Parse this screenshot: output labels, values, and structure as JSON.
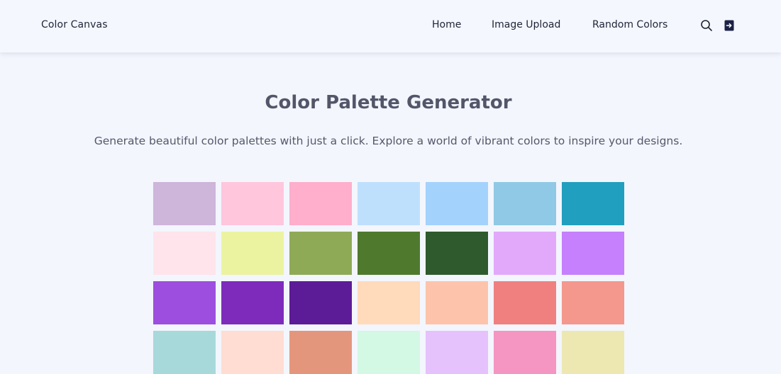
{
  "navbar": {
    "brand": "Color Canvas",
    "links": [
      "Home",
      "Image Upload",
      "Random Colors"
    ],
    "search_icon": "search-icon",
    "logout_icon": "logout-icon"
  },
  "main": {
    "title": "Color Palette Generator",
    "subtitle": "Generate beautiful color palettes with just a click. Explore a world of vibrant colors to inspire your designs."
  },
  "palette": [
    "#ceb5da",
    "#ffc6dc",
    "#ffaecb",
    "#bfe0fd",
    "#a3d2fd",
    "#8fc9e5",
    "#209fbe",
    "#ffe4ec",
    "#ebf3a1",
    "#8faa56",
    "#4f7a2e",
    "#2f5a2d",
    "#e2a9fb",
    "#c67ffd",
    "#9d4ede",
    "#7e2bbc",
    "#5c1b97",
    "#ffdabb",
    "#fdc4ab",
    "#f08080",
    "#f4978d",
    "#a7d9db",
    "#ffddd2",
    "#e4967d",
    "#d3f8e3",
    "#e5c2fb",
    "#f595c1",
    "#ede7b2"
  ]
}
